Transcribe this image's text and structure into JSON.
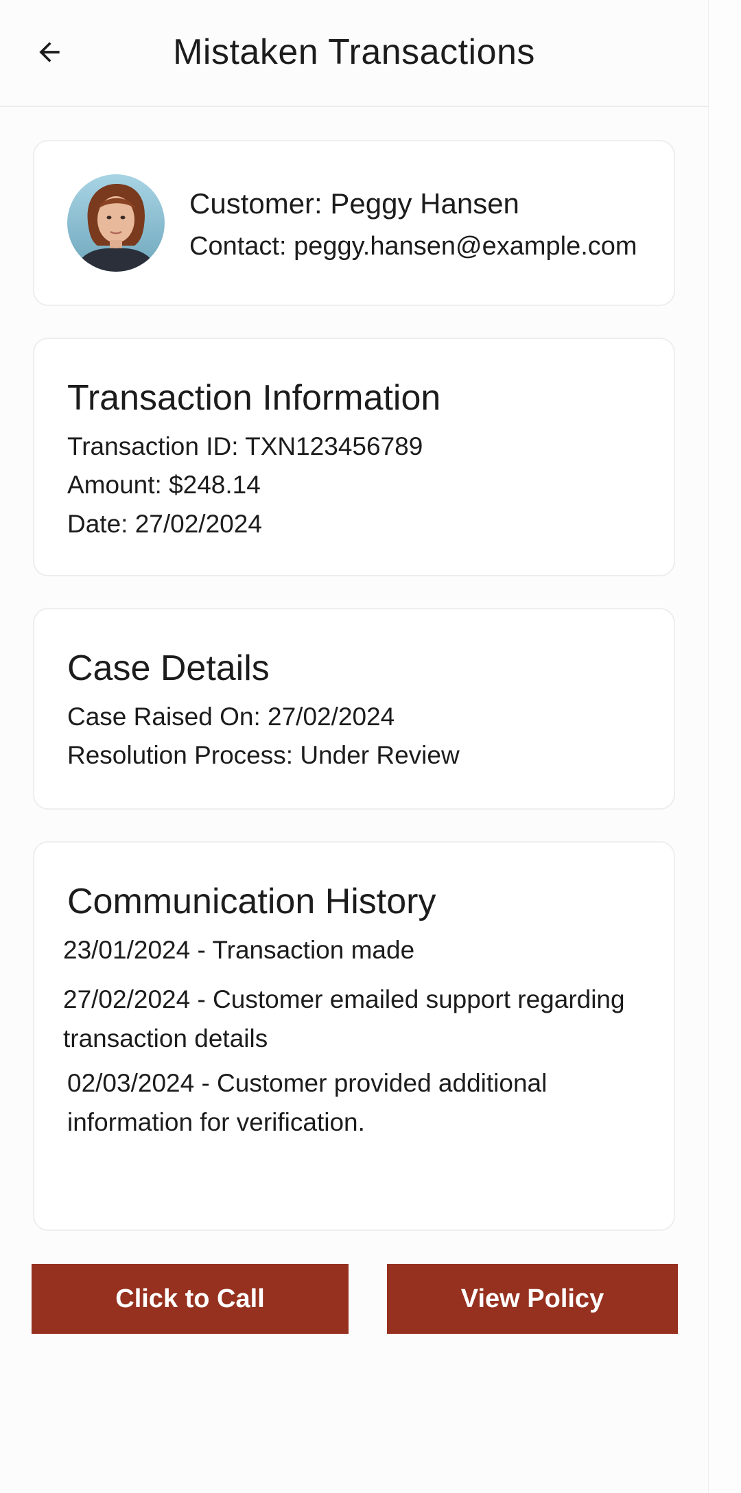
{
  "header": {
    "title": "Mistaken Transactions",
    "back_icon": "arrow-left-icon"
  },
  "customer": {
    "name_line": "Customer: Peggy Hansen",
    "contact_line": "Contact: peggy.hansen@example.com",
    "avatar_icon": "customer-avatar"
  },
  "transaction": {
    "title": "Transaction Information",
    "id_line": "Transaction ID: TXN123456789",
    "amount_line": "Amount: $248.14",
    "date_line": "Date: 27/02/2024"
  },
  "case": {
    "title": "Case Details",
    "raised_line": "Case Raised On: 27/02/2024",
    "resolution_line": "Resolution Process: Under Review"
  },
  "communication": {
    "title": "Communication History",
    "entries": [
      "23/01/2024 - Transaction made",
      "27/02/2024 - Customer emailed support regarding transaction details",
      "02/03/2024 - Customer provided additional information for verification."
    ]
  },
  "actions": {
    "call_label": "Click to Call",
    "policy_label": "View Policy",
    "button_color": "#96311f"
  }
}
